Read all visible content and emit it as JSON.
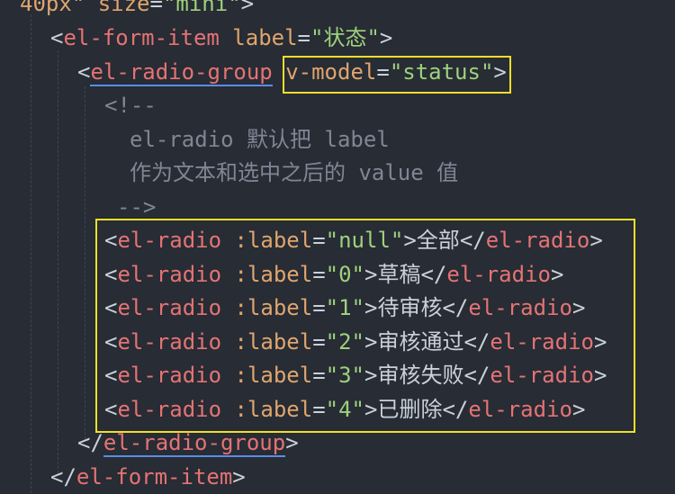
{
  "line0": {
    "attr": "40px\"",
    "attr2": "size",
    "val": "\"mini\"",
    "close": ">"
  },
  "form_item": {
    "open": "<",
    "tag": "el-form-item",
    "attr": "label",
    "eq": "=",
    "val": "\"状态\"",
    "close": ">"
  },
  "radio_group": {
    "open": "<",
    "tag": "el-radio-group",
    "attr": "v-model",
    "eq": "=",
    "val": "\"status\"",
    "close": ">"
  },
  "comment": {
    "open": "<!--",
    "line1": "el-radio 默认把 label",
    "line2": "作为文本和选中之后的 value 值",
    "close": "-->"
  },
  "radios": [
    {
      "value": "\"null\"",
      "text": "全部"
    },
    {
      "value": "\"0\"",
      "text": "草稿"
    },
    {
      "value": "\"1\"",
      "text": "待审核"
    },
    {
      "value": "\"2\"",
      "text": "审核通过"
    },
    {
      "value": "\"3\"",
      "text": "审核失败"
    },
    {
      "value": "\"4\"",
      "text": "已删除"
    }
  ],
  "radio_tag": {
    "open": "<",
    "tag": "el-radio",
    "attr": ":label",
    "eq": "=",
    "gt": ">",
    "end_open": "</",
    "end_close": ">"
  },
  "radio_group_end": {
    "open": "</",
    "tag": "el-radio-group",
    "close": ">"
  },
  "form_item_end": {
    "open": "</",
    "tag": "el-form-item",
    "close": ">"
  },
  "colors": {
    "background": "#272c35",
    "tag": "#e57373",
    "attribute": "#e0a56d",
    "string": "#9fd17c",
    "comment": "#7f8794",
    "highlight_box": "#f2df29"
  }
}
